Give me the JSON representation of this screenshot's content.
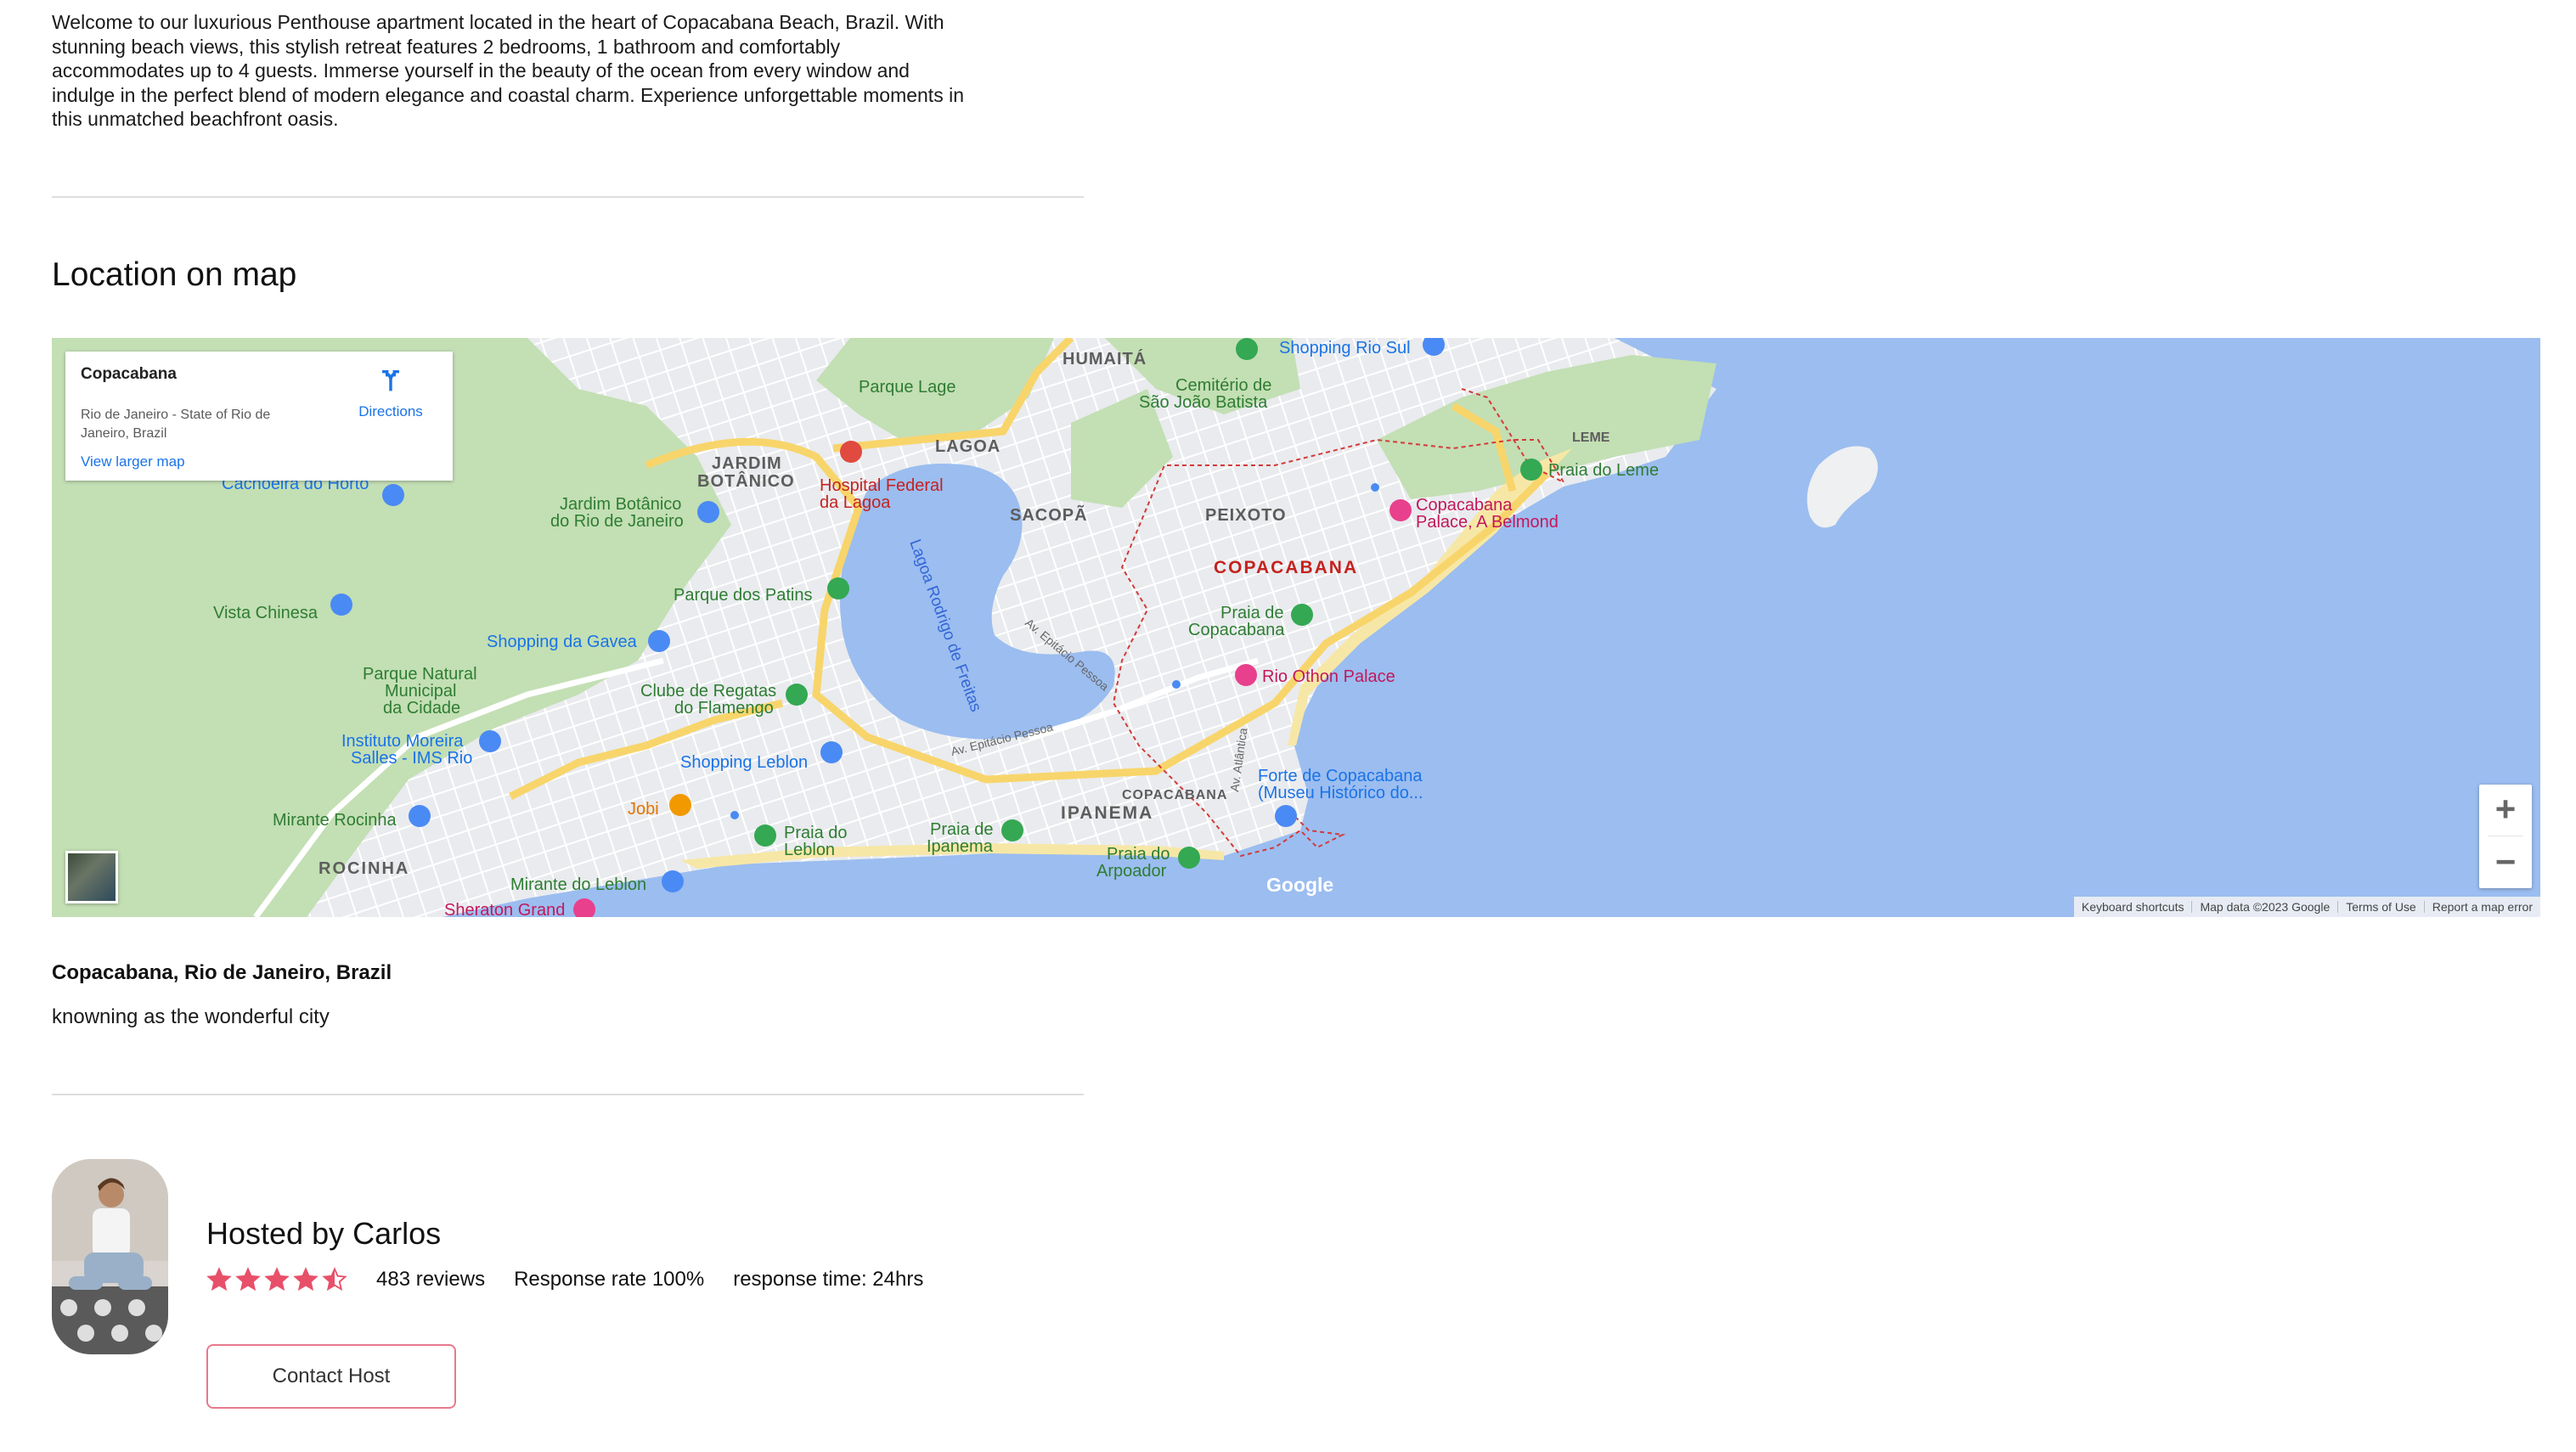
{
  "listing": {
    "description": "Welcome to our luxurious Penthouse apartment located in the heart of Copacabana Beach, Brazil. With stunning beach views, this stylish retreat features 2 bedrooms, 1 bathroom and comfortably accommodates up to 4 guests. Immerse yourself in the beauty of the ocean from every window and indulge in the perfect blend of modern elegance and coastal charm. Experience unforgettable moments in this unmatched beachfront oasis."
  },
  "map_section": {
    "title": "Location on map",
    "place_card": {
      "name": "Copacabana",
      "address": "Rio de Janeiro - State of Rio de Janeiro, Brazil",
      "view_larger": "View larger map",
      "directions": "Directions"
    },
    "labels": {
      "humaita": "HUMAITÁ",
      "shopping_rio_sul": "Shopping Rio Sul",
      "parque_lage": "Parque Lage",
      "cemiterio_1": "Cemitério de",
      "cemiterio_2": "São João Batista",
      "lagoa": "LAGOA",
      "jardim_1": "JARDIM",
      "jardim_2": "BOTÂNICO",
      "hospital_1": "Hospital Federal",
      "hospital_2": "da Lagoa",
      "leme": "LEME",
      "praia_leme": "Praia do Leme",
      "cachoeira": "Cachoeira do Horto",
      "jardim_botanico_1": "Jardim Botânico",
      "jardim_botanico_2": "do Rio de Janeiro",
      "sacopa": "SACOPÃ",
      "peixoto": "PEIXOTO",
      "copacabana_palace_1": "Copacabana",
      "copacabana_palace_2": "Palace, A Belmond",
      "copacabana": "COPACABANA",
      "parque_patins": "Parque dos Patins",
      "lagoa_rodrigo": "Lagoa Rodrigo de Freitas",
      "vista_chinesa": "Vista Chinesa",
      "praia_copa_1": "Praia de",
      "praia_copa_2": "Copacabana",
      "shopping_gavea": "Shopping da Gavea",
      "av_epitacio_1": "Av. Epitácio Pessoa",
      "rio_othon": "Rio Othon Palace",
      "parque_natural_1": "Parque Natural",
      "parque_natural_2": "Municipal",
      "parque_natural_3": "da Cidade",
      "clube_1": "Clube de Regatas",
      "clube_2": "do Flamengo",
      "instituto_1": "Instituto Moreira",
      "instituto_2": "Salles - IMS Rio",
      "av_epitacio_2": "Av. Epitácio Pessoa",
      "shopping_leblon": "Shopping Leblon",
      "forte_1": "Forte de Copacabana",
      "forte_2": "(Museu Histórico do...",
      "av_atlantica": "Av. Atlântica",
      "copacabana_small": "COPACABANA",
      "jobi": "Jobi",
      "ipanema": "IPANEMA",
      "mirante_rocinha": "Mirante Rocinha",
      "praia_leblon_1": "Praia do",
      "praia_leblon_2": "Leblon",
      "praia_ipanema_1": "Praia de",
      "praia_ipanema_2": "Ipanema",
      "praia_arpoador_1": "Praia do",
      "praia_arpoador_2": "Arpoador",
      "rocinha": "ROCINHA",
      "mirante_leblon": "Mirante do Leblon",
      "sheraton": "Sheraton Grand",
      "google": "Google"
    },
    "zoom_in": "+",
    "zoom_out": "−",
    "attribution": {
      "shortcuts": "Keyboard shortcuts",
      "map_data": "Map data ©2023 Google",
      "terms": "Terms of Use",
      "report": "Report a map error"
    }
  },
  "location": {
    "title": "Copacabana, Rio de Janeiro, Brazil",
    "subtitle": "knowning as the wonderful city"
  },
  "host": {
    "name": "Hosted by Carlos",
    "rating": 4.5,
    "reviews": "483 reviews",
    "response_rate": "Response rate 100%",
    "response_time": "response time: 24hrs",
    "contact_label": "Contact Host",
    "star_color": "#e8506a"
  },
  "colors": {
    "water": "#9bbdf0",
    "park": "#c3dfb4",
    "urban": "#e8eaed",
    "road_major": "#f8d56b",
    "beach": "#f7e7a6",
    "poi_green": "#34a853",
    "poi_blue": "#4a8af4",
    "poi_pink": "#e8408c",
    "poi_red": "#e04a3f",
    "poi_orange": "#f29900",
    "boundary": "#d33a3a",
    "label_district": "#5d5d5d",
    "label_copacabana": "#c5221f"
  }
}
